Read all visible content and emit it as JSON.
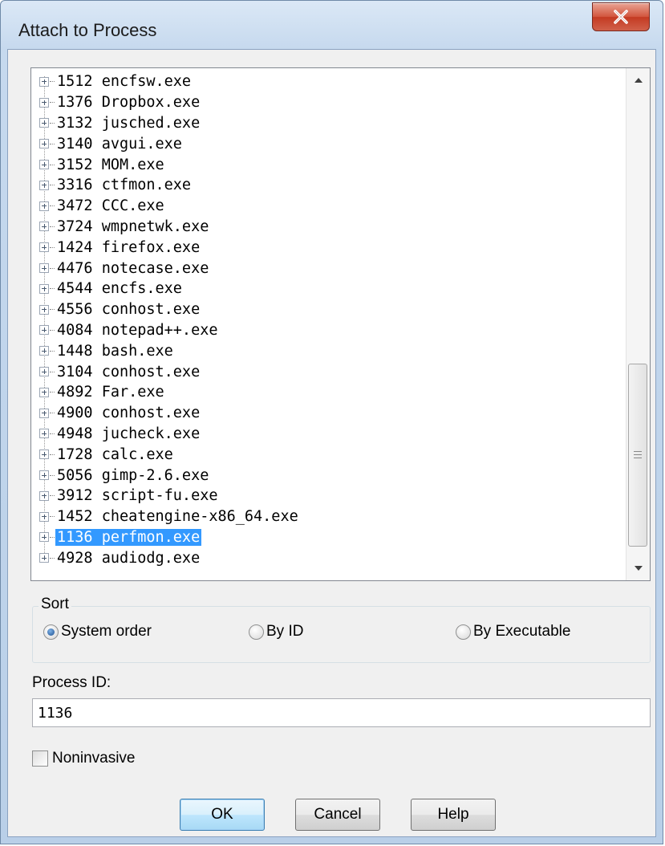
{
  "window": {
    "title": "Attach to Process",
    "close_glyph": "X"
  },
  "process_list": {
    "items": [
      {
        "label": "1512 encfsw.exe"
      },
      {
        "label": "1376 Dropbox.exe"
      },
      {
        "label": "3132 jusched.exe"
      },
      {
        "label": "3140 avgui.exe"
      },
      {
        "label": "3152 MOM.exe"
      },
      {
        "label": "3316 ctfmon.exe"
      },
      {
        "label": "3472 CCC.exe"
      },
      {
        "label": "3724 wmpnetwk.exe"
      },
      {
        "label": "1424 firefox.exe"
      },
      {
        "label": "4476 notecase.exe"
      },
      {
        "label": "4544 encfs.exe"
      },
      {
        "label": "4556 conhost.exe"
      },
      {
        "label": "4084 notepad++.exe"
      },
      {
        "label": "1448 bash.exe"
      },
      {
        "label": "3104 conhost.exe"
      },
      {
        "label": "4892 Far.exe"
      },
      {
        "label": "4900 conhost.exe"
      },
      {
        "label": "4948 jucheck.exe"
      },
      {
        "label": "1728 calc.exe"
      },
      {
        "label": "5056 gimp-2.6.exe"
      },
      {
        "label": "3912 script-fu.exe"
      },
      {
        "label": "1452 cheatengine-x86_64.exe"
      },
      {
        "label": "1136 perfmon.exe"
      },
      {
        "label": "4928 audiodg.exe"
      }
    ],
    "selected": "1136 perfmon.exe"
  },
  "sort": {
    "legend": "Sort",
    "options": [
      {
        "label": "System order",
        "checked": true
      },
      {
        "label": "By ID",
        "checked": false
      },
      {
        "label": "By Executable",
        "checked": false
      }
    ]
  },
  "process_id": {
    "label": "Process ID:",
    "value": "1136"
  },
  "noninvasive": {
    "label": "Noninvasive",
    "checked": false
  },
  "buttons": {
    "ok": "OK",
    "cancel": "Cancel",
    "help": "Help"
  },
  "colors": {
    "selection": "#3399ff",
    "close_button": "#c43a22"
  }
}
